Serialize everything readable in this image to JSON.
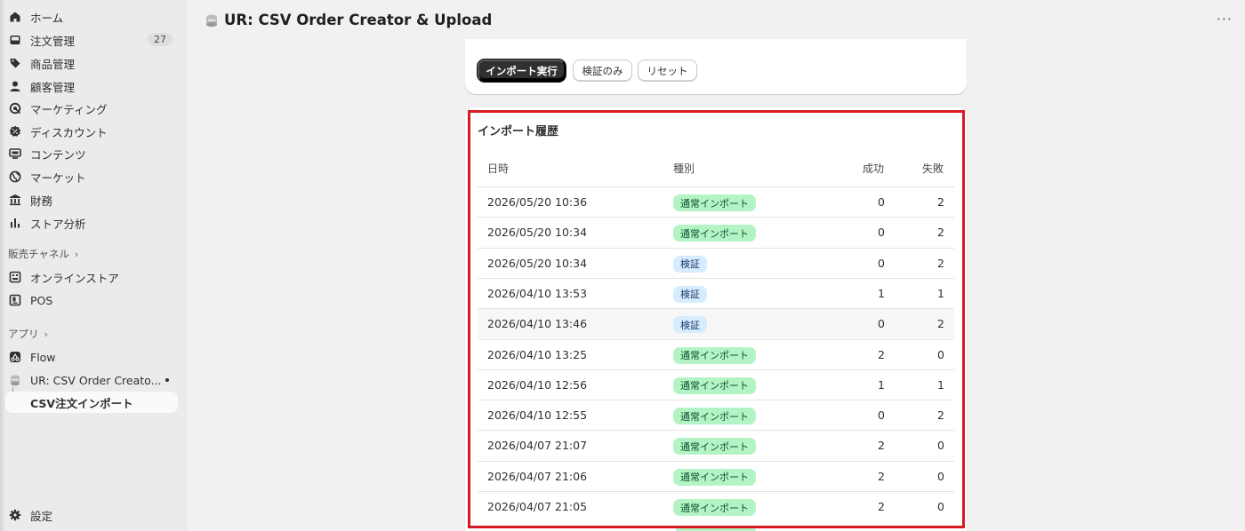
{
  "sidebar": {
    "items": [
      {
        "label": "ホーム"
      },
      {
        "label": "注文管理",
        "badge": "27"
      },
      {
        "label": "商品管理"
      },
      {
        "label": "顧客管理"
      },
      {
        "label": "マーケティング"
      },
      {
        "label": "ディスカウント"
      },
      {
        "label": "コンテンツ"
      },
      {
        "label": "マーケット"
      },
      {
        "label": "財務"
      },
      {
        "label": "ストア分析"
      }
    ],
    "sales_channels": {
      "label": "販売チャネル",
      "items": [
        {
          "label": "オンラインストア"
        },
        {
          "label": "POS"
        }
      ]
    },
    "apps": {
      "label": "アプリ",
      "items": [
        {
          "label": "Flow"
        },
        {
          "label": "UR: CSV Order Creato..."
        }
      ],
      "sub_item": {
        "label": "CSV注文インポート"
      }
    },
    "settings": {
      "label": "設定"
    }
  },
  "header": {
    "title": "UR: CSV Order Creator & Upload",
    "more": "···"
  },
  "actions": {
    "import": "インポート実行",
    "verify_only": "検証のみ",
    "reset": "リセット"
  },
  "history": {
    "title": "インポート履歴",
    "columns": {
      "datetime": "日時",
      "type": "種別",
      "success": "成功",
      "fail": "失敗"
    },
    "rows": [
      {
        "datetime": "2026/05/20 10:36",
        "type": "通常インポート",
        "kind": "import",
        "success": "0",
        "fail": "2"
      },
      {
        "datetime": "2026/05/20 10:34",
        "type": "通常インポート",
        "kind": "import",
        "success": "0",
        "fail": "2"
      },
      {
        "datetime": "2026/05/20 10:34",
        "type": "検証",
        "kind": "verify",
        "success": "0",
        "fail": "2"
      },
      {
        "datetime": "2026/04/10 13:53",
        "type": "検証",
        "kind": "verify",
        "success": "1",
        "fail": "1"
      },
      {
        "datetime": "2026/04/10 13:46",
        "type": "検証",
        "kind": "verify",
        "success": "0",
        "fail": "2"
      },
      {
        "datetime": "2026/04/10 13:25",
        "type": "通常インポート",
        "kind": "import",
        "success": "2",
        "fail": "0"
      },
      {
        "datetime": "2026/04/10 12:56",
        "type": "通常インポート",
        "kind": "import",
        "success": "1",
        "fail": "1"
      },
      {
        "datetime": "2026/04/10 12:55",
        "type": "通常インポート",
        "kind": "import",
        "success": "0",
        "fail": "2"
      },
      {
        "datetime": "2026/04/07 21:07",
        "type": "通常インポート",
        "kind": "import",
        "success": "2",
        "fail": "0"
      },
      {
        "datetime": "2026/04/07 21:06",
        "type": "通常インポート",
        "kind": "import",
        "success": "2",
        "fail": "0"
      },
      {
        "datetime": "2026/04/07 21:05",
        "type": "通常インポート",
        "kind": "import",
        "success": "2",
        "fail": "0"
      }
    ]
  },
  "colors": {
    "highlight_border": "#d71921",
    "badge_import_bg": "#b4f4c4",
    "badge_verify_bg": "#d6ecff",
    "primary_button": "#303030"
  }
}
